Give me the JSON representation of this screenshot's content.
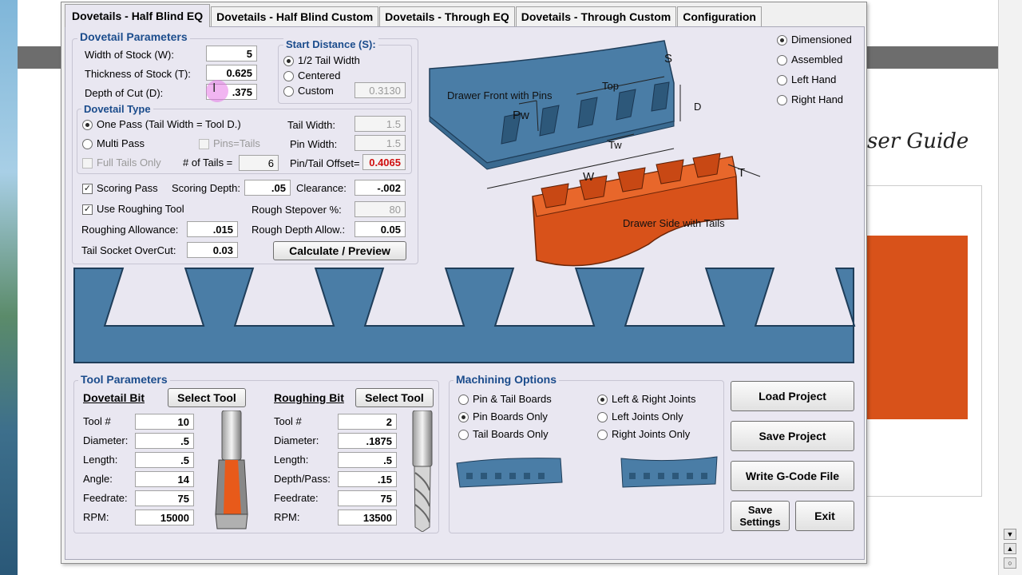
{
  "tabs": [
    {
      "label": "Dovetails - Half Blind EQ",
      "active": true
    },
    {
      "label": "Dovetails - Half Blind Custom",
      "active": false
    },
    {
      "label": "Dovetails - Through EQ",
      "active": false
    },
    {
      "label": "Dovetails - Through Custom",
      "active": false
    },
    {
      "label": "Configuration",
      "active": false
    }
  ],
  "background": {
    "guide_text": "ser Guide"
  },
  "dovetail_params": {
    "title": "Dovetail Parameters",
    "width_label": "Width of Stock (W):",
    "width_value": "5",
    "thickness_label": "Thickness of Stock (T):",
    "thickness_value": "0.625",
    "depth_label": "Depth of Cut (D):",
    "depth_value": ".375"
  },
  "start_distance": {
    "title": "Start Distance (S):",
    "options": [
      {
        "label": "1/2 Tail Width",
        "selected": true
      },
      {
        "label": "Centered",
        "selected": false
      },
      {
        "label": "Custom",
        "selected": false
      }
    ],
    "custom_value": "0.3130"
  },
  "dovetail_type": {
    "title": "Dovetail Type",
    "one_pass_label": "One Pass (Tail Width = Tool D.)",
    "one_pass_selected": true,
    "multi_pass_label": "Multi Pass",
    "multi_pass_selected": false,
    "pins_tails_label": "Pins=Tails",
    "full_tails_label": "Full Tails Only",
    "num_tails_label": "# of Tails =",
    "num_tails_value": "6",
    "tail_width_label": "Tail Width:",
    "tail_width_value": "1.5",
    "pin_width_label": "Pin Width:",
    "pin_width_value": "1.5",
    "offset_label": "Pin/Tail Offset=",
    "offset_value": "0.4065"
  },
  "passes": {
    "scoring_label": "Scoring Pass",
    "scoring_checked": true,
    "scoring_depth_label": "Scoring Depth:",
    "scoring_depth_value": ".05",
    "clearance_label": "Clearance:",
    "clearance_value": "-.002",
    "roughing_label": "Use Roughing Tool",
    "roughing_checked": true,
    "stepover_label": "Rough Stepover %:",
    "stepover_value": "80",
    "allowance_label": "Roughing Allowance:",
    "allowance_value": ".015",
    "rough_depth_label": "Rough Depth Allow.:",
    "rough_depth_value": "0.05",
    "overcut_label": "Tail Socket OverCut:",
    "overcut_value": "0.03",
    "calc_label": "Calculate / Preview"
  },
  "diagram": {
    "front_label": "Drawer Front with Pins",
    "side_label": "Drawer Side with Tails",
    "top": "Top",
    "s": "S",
    "d": "D",
    "pw": "Pw",
    "tw": "Tw",
    "w": "W",
    "t": "T"
  },
  "view_options": [
    {
      "label": "Dimensioned",
      "selected": true
    },
    {
      "label": "Assembled",
      "selected": false
    },
    {
      "label": "Left Hand",
      "selected": false
    },
    {
      "label": "Right Hand",
      "selected": false
    }
  ],
  "preview": {
    "slot_count": 6,
    "board_color": "#4a7da6",
    "edge_color": "#1f3e5a"
  },
  "tool_params": {
    "title": "Tool Parameters",
    "dovetail": {
      "heading": "Dovetail Bit",
      "select_label": "Select Tool",
      "rows": [
        {
          "label": "Tool #",
          "value": "10"
        },
        {
          "label": "Diameter:",
          "value": ".5"
        },
        {
          "label": "Length:",
          "value": ".5"
        },
        {
          "label": "Angle:",
          "value": "14"
        },
        {
          "label": "Feedrate:",
          "value": "75"
        },
        {
          "label": "RPM:",
          "value": "15000"
        }
      ]
    },
    "roughing": {
      "heading": "Roughing Bit",
      "select_label": "Select Tool",
      "rows": [
        {
          "label": "Tool #",
          "value": "2"
        },
        {
          "label": "Diameter:",
          "value": ".1875"
        },
        {
          "label": "Length:",
          "value": ".5"
        },
        {
          "label": "Depth/Pass:",
          "value": ".15"
        },
        {
          "label": "Feedrate:",
          "value": "75"
        },
        {
          "label": "RPM:",
          "value": "13500"
        }
      ]
    }
  },
  "machining": {
    "title": "Machining Options",
    "boards": [
      {
        "label": "Pin & Tail Boards",
        "selected": false
      },
      {
        "label": "Pin Boards Only",
        "selected": true
      },
      {
        "label": "Tail Boards Only",
        "selected": false
      }
    ],
    "joints": [
      {
        "label": "Left & Right Joints",
        "selected": true
      },
      {
        "label": "Left Joints Only",
        "selected": false
      },
      {
        "label": "Right Joints Only",
        "selected": false
      }
    ]
  },
  "actions": {
    "load": "Load Project",
    "save": "Save Project",
    "gcode": "Write G-Code File",
    "save_settings_1": "Save",
    "save_settings_2": "Settings",
    "exit": "Exit"
  },
  "colors": {
    "accent_title": "#1b4c8c",
    "wood_blue": "#4a7da6",
    "wood_orange": "#d8521a",
    "offset_red": "#d01010"
  }
}
